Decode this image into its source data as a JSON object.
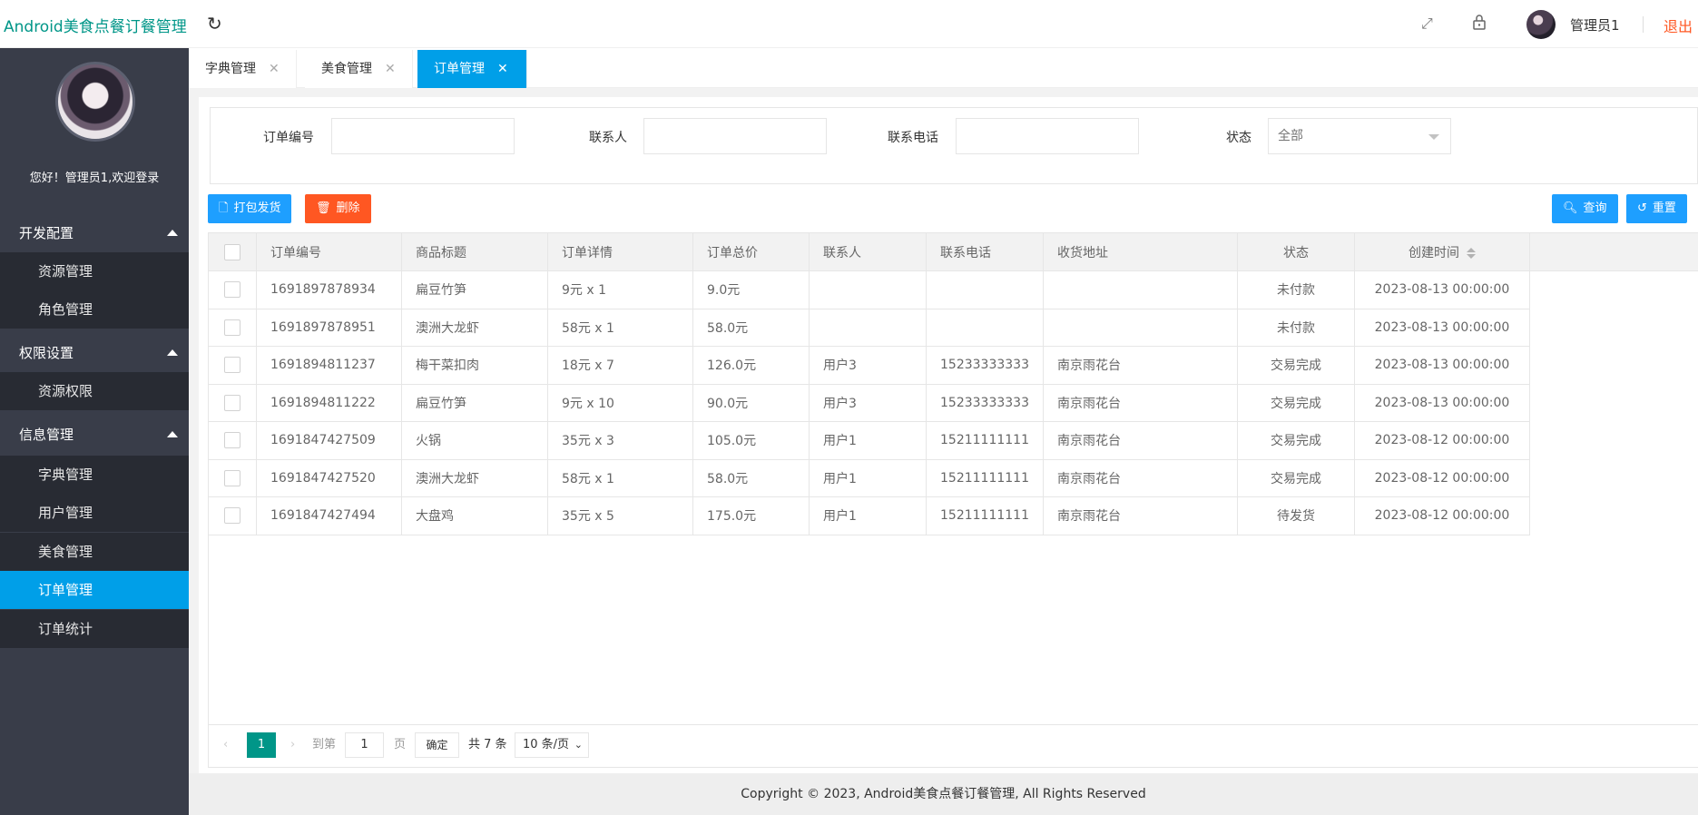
{
  "header": {
    "app_title": "Android美食点餐订餐管理",
    "user_name": "管理员1",
    "logout": "退出"
  },
  "sidebar": {
    "welcome": "您好！管理员1,欢迎登录",
    "groups": [
      {
        "label": "开发配置",
        "items": [
          {
            "label": "资源管理"
          },
          {
            "label": "角色管理"
          }
        ]
      },
      {
        "label": "权限设置",
        "items": [
          {
            "label": "资源权限"
          }
        ]
      },
      {
        "label": "信息管理",
        "items": [
          {
            "label": "字典管理"
          },
          {
            "label": "用户管理"
          },
          {
            "label": "美食管理"
          },
          {
            "label": "订单管理",
            "active": true
          },
          {
            "label": "订单统计"
          }
        ]
      }
    ]
  },
  "tabs": [
    {
      "label": "字典管理"
    },
    {
      "label": "美食管理"
    },
    {
      "label": "订单管理",
      "active": true
    }
  ],
  "search": {
    "order_no_label": "订单编号",
    "contact_label": "联系人",
    "phone_label": "联系电话",
    "status_label": "状态",
    "status_value": "全部"
  },
  "toolbar": {
    "ship_label": "打包发货",
    "delete_label": "删除",
    "query_label": "查询",
    "reset_label": "重置"
  },
  "table": {
    "headers": [
      "订单编号",
      "商品标题",
      "订单详情",
      "订单总价",
      "联系人",
      "联系电话",
      "收货地址",
      "状态",
      "创建时间"
    ],
    "rows": [
      [
        "1691897878934",
        "扁豆竹笋",
        "9元 x 1",
        "9.0元",
        "",
        "",
        "",
        "未付款",
        "2023-08-13 00:00:00"
      ],
      [
        "1691897878951",
        "澳洲大龙虾",
        "58元 x 1",
        "58.0元",
        "",
        "",
        "",
        "未付款",
        "2023-08-13 00:00:00"
      ],
      [
        "1691894811237",
        "梅干菜扣肉",
        "18元 x 7",
        "126.0元",
        "用户3",
        "15233333333",
        "南京雨花台",
        "交易完成",
        "2023-08-13 00:00:00"
      ],
      [
        "1691894811222",
        "扁豆竹笋",
        "9元 x 10",
        "90.0元",
        "用户3",
        "15233333333",
        "南京雨花台",
        "交易完成",
        "2023-08-13 00:00:00"
      ],
      [
        "1691847427509",
        "火锅",
        "35元 x 3",
        "105.0元",
        "用户1",
        "15211111111",
        "南京雨花台",
        "交易完成",
        "2023-08-12 00:00:00"
      ],
      [
        "1691847427520",
        "澳洲大龙虾",
        "58元 x 1",
        "58.0元",
        "用户1",
        "15211111111",
        "南京雨花台",
        "交易完成",
        "2023-08-12 00:00:00"
      ],
      [
        "1691847427494",
        "大盘鸡",
        "35元 x 5",
        "175.0元",
        "用户1",
        "15211111111",
        "南京雨花台",
        "待发货",
        "2023-08-12 00:00:00"
      ]
    ]
  },
  "pager": {
    "current": "1",
    "goto_label": "到第",
    "goto_value": "1",
    "page_unit": "页",
    "confirm": "确定",
    "total": "共 7 条",
    "page_size": "10 条/页"
  },
  "footer": {
    "copyright": "Copyright © 2023, Android美食点餐订餐管理, All Rights Reserved"
  },
  "colors": {
    "accent": "#009fe8",
    "brand": "#009688",
    "danger": "#ff5722",
    "sidebar": "#393d49"
  }
}
